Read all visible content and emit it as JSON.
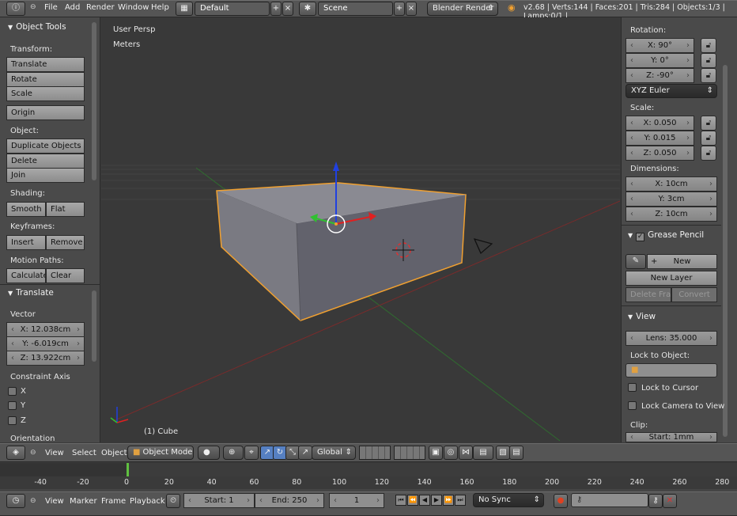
{
  "topbar": {
    "menus": [
      "File",
      "Add",
      "Render",
      "Window",
      "Help"
    ],
    "layout": "Default",
    "scene": "Scene",
    "engine": "Blender Render",
    "stats": "v2.68 | Verts:144 | Faces:201 | Tris:284 | Objects:1/3 | Lamps:0/1 |"
  },
  "tool_panel": {
    "title": "Object Tools",
    "transform_label": "Transform:",
    "translate": "Translate",
    "rotate": "Rotate",
    "scale": "Scale",
    "origin": "Origin",
    "object_label": "Object:",
    "duplicate": "Duplicate Objects",
    "delete": "Delete",
    "join": "Join",
    "shading_label": "Shading:",
    "smooth": "Smooth",
    "flat": "Flat",
    "keyframes_label": "Keyframes:",
    "insert": "Insert",
    "remove": "Remove",
    "motion_label": "Motion Paths:",
    "calculate": "Calculate",
    "clear": "Clear"
  },
  "operator_panel": {
    "title": "Translate",
    "vector_label": "Vector",
    "x": "X: 12.038cm",
    "y": "Y: -6.019cm",
    "z": "Z: 13.922cm",
    "constraint_label": "Constraint Axis",
    "axes": [
      "X",
      "Y",
      "Z"
    ],
    "orientation_label": "Orientation"
  },
  "viewport": {
    "view_name": "User Persp",
    "units": "Meters",
    "object_info": "(1) Cube"
  },
  "properties": {
    "rotation_label": "Rotation:",
    "rot_x": "X: 90°",
    "rot_y": "Y: 0°",
    "rot_z": "Z: -90°",
    "rot_mode": "XYZ Euler",
    "scale_label": "Scale:",
    "scale_x": "X: 0.050",
    "scale_y": "Y: 0.015",
    "scale_z": "Z: 0.050",
    "dimensions_label": "Dimensions:",
    "dim_x": "X: 10cm",
    "dim_y": "Y: 3cm",
    "dim_z": "Z: 10cm",
    "grease_title": "Grease Pencil",
    "new": "New",
    "new_layer": "New Layer",
    "delete_frame": "Delete Frame",
    "convert": "Convert",
    "view_title": "View",
    "lens": "Lens: 35.000",
    "lock_object_label": "Lock to Object:",
    "lock_cursor": "Lock to Cursor",
    "lock_camera": "Lock Camera to View",
    "clip_label": "Clip:",
    "clip_start": "Start: 1mm"
  },
  "view_header": {
    "view": "View",
    "select": "Select",
    "object": "Object",
    "mode": "Object Mode",
    "orientation": "Global"
  },
  "timeline": {
    "ticks": [
      "-40",
      "-20",
      "0",
      "20",
      "40",
      "60",
      "80",
      "100",
      "120",
      "140",
      "160",
      "180",
      "200",
      "220",
      "240",
      "260",
      "280"
    ],
    "current_frame_value": 0
  },
  "timeline_header": {
    "view": "View",
    "marker": "Marker",
    "frame": "Frame",
    "playback": "Playback",
    "start": "Start: 1",
    "end": "End: 250",
    "current": "1",
    "sync": "No Sync"
  },
  "colors": {
    "selection": "#f0a030",
    "x_axis": "#e02020",
    "y_axis": "#30c030",
    "z_axis": "#2040e0"
  }
}
